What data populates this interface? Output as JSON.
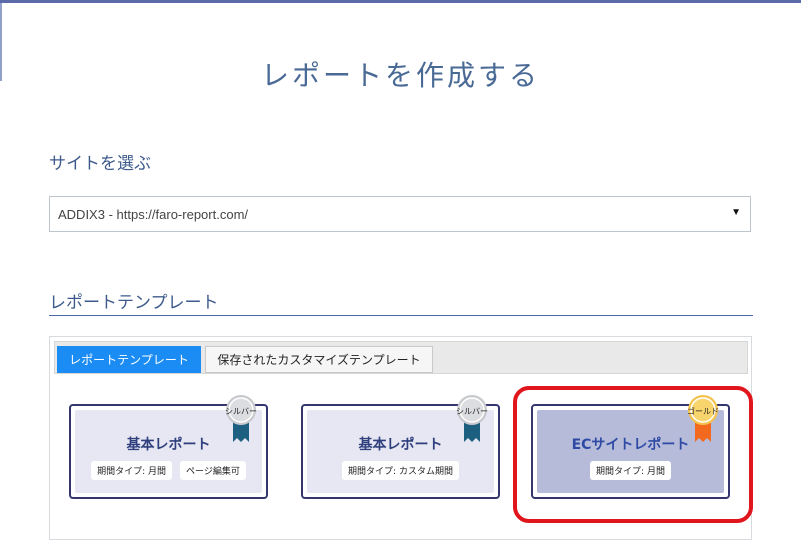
{
  "page": {
    "title": "レポートを作成する"
  },
  "site_section": {
    "heading": "サイトを選ぶ",
    "select_value": "ADDIX3 - https://faro-report.com/",
    "arrow_icon": "triangle-down-icon"
  },
  "template_section": {
    "heading": "レポートテンプレート",
    "tabs": [
      {
        "label": "レポートテンプレート",
        "active": true
      },
      {
        "label": "保存されたカスタマイズテンプレート",
        "active": false
      }
    ],
    "cards": [
      {
        "title": "基本レポート",
        "badge": "シルバー",
        "tags": [
          "期間タイプ: 月間",
          "ページ編集可"
        ],
        "selected": false
      },
      {
        "title": "基本レポート",
        "badge": "シルバー",
        "tags": [
          "期間タイプ: カスタム期間"
        ],
        "selected": false
      },
      {
        "title": "ECサイトレポート",
        "badge": "ゴールド",
        "tags": [
          "期間タイプ: 月間"
        ],
        "selected": true
      }
    ]
  },
  "colors": {
    "accent": "#1b8cf4",
    "title": "#4a6a96",
    "highlight": "#e0161c",
    "silver": "#c7c9cd",
    "gold": "#f4c24d",
    "ribbon_teal": "#1c5f80",
    "ribbon_orange": "#f36a1e"
  }
}
